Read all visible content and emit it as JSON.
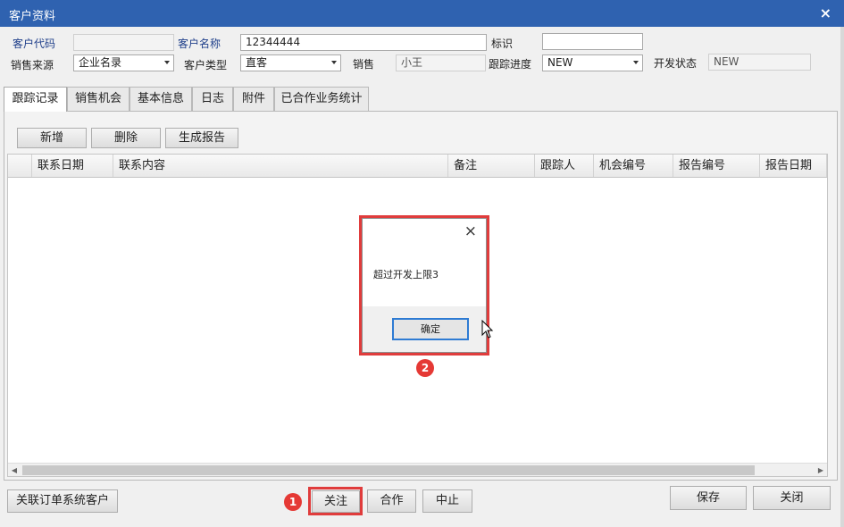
{
  "window": {
    "title": "客户资料",
    "close_symbol": "×"
  },
  "form": {
    "customer_code_label": "客户代码",
    "customer_code_value": "",
    "customer_name_label": "客户名称",
    "customer_name_value": "12344444",
    "tag_label": "标识",
    "tag_value": "",
    "sales_source_label": "销售来源",
    "sales_source_value": "企业名录",
    "customer_type_label": "客户类型",
    "customer_type_value": "直客",
    "sales_label": "销售",
    "sales_value": "小王",
    "progress_label": "跟踪进度",
    "progress_value": "NEW",
    "dev_status_label": "开发状态",
    "dev_status_value": "NEW"
  },
  "tabs": [
    {
      "label": "跟踪记录",
      "active": true
    },
    {
      "label": "销售机会",
      "active": false
    },
    {
      "label": "基本信息",
      "active": false
    },
    {
      "label": "日志",
      "active": false
    },
    {
      "label": "附件",
      "active": false
    },
    {
      "label": "已合作业务统计",
      "active": false
    }
  ],
  "toolbar": {
    "add_label": "新增",
    "delete_label": "删除",
    "report_label": "生成报告"
  },
  "grid": {
    "columns": [
      "联系日期",
      "联系内容",
      "备注",
      "跟踪人",
      "机会编号",
      "报告编号",
      "报告日期"
    ],
    "rows": []
  },
  "dialog": {
    "message": "超过开发上限3",
    "ok_label": "确定",
    "close_symbol": "×"
  },
  "footer": {
    "link_customer_label": "关联订单系统客户",
    "follow_label": "关注",
    "cooperate_label": "合作",
    "stop_label": "中止",
    "save_label": "保存",
    "close_label": "关闭"
  },
  "annotations": {
    "badge1": "1",
    "badge2": "2",
    "color": "#e03c3c"
  },
  "colors": {
    "titlebar": "#2f62b0",
    "window_bg": "#f0f0f0",
    "dialog_focus": "#2e7bd3"
  }
}
